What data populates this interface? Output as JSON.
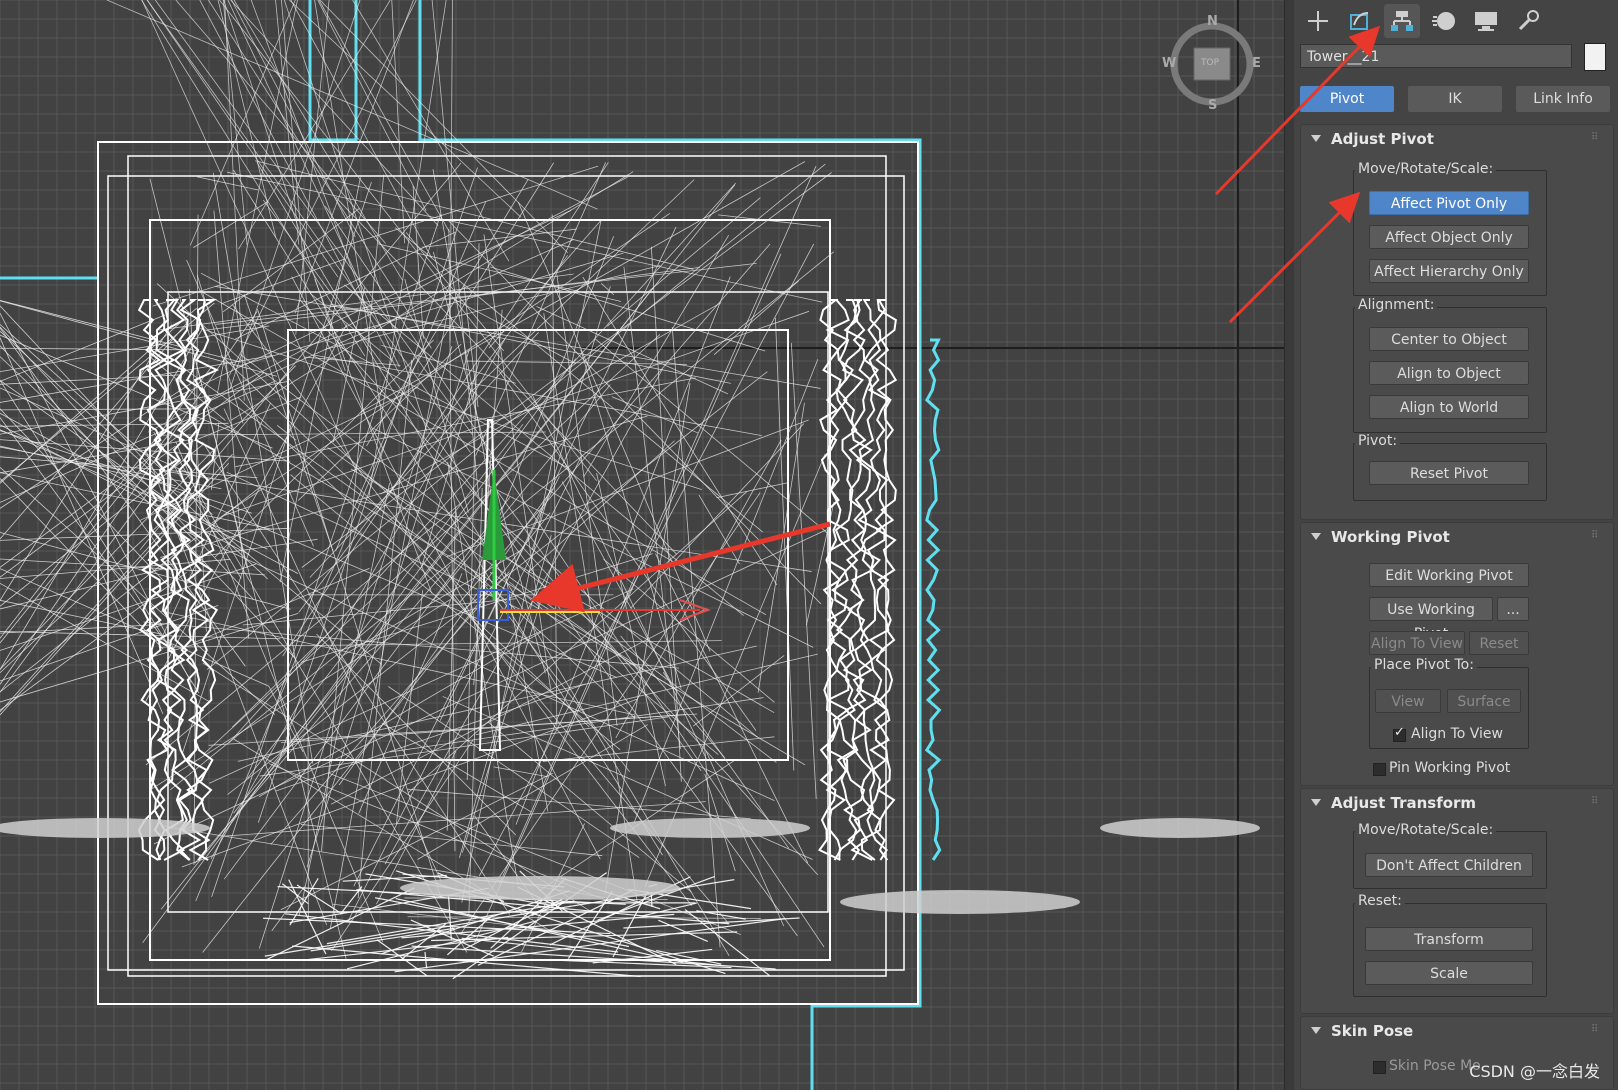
{
  "toolbar": {
    "tabs": [
      {
        "icon": "create-icon",
        "active": false
      },
      {
        "icon": "modify-icon",
        "active": false
      },
      {
        "icon": "hierarchy-icon",
        "active": true
      },
      {
        "icon": "motion-icon",
        "active": false
      },
      {
        "icon": "display-icon",
        "active": false
      },
      {
        "icon": "utilities-icon",
        "active": false
      }
    ]
  },
  "object_name": "Tower__21",
  "subtabs": [
    {
      "label": "Pivot",
      "active": true
    },
    {
      "label": "IK",
      "active": false
    },
    {
      "label": "Link Info",
      "active": false
    }
  ],
  "adjust_pivot": {
    "title": "Adjust Pivot",
    "move_group_label": "Move/Rotate/Scale:",
    "affect_pivot_only": "Affect Pivot Only",
    "affect_object_only": "Affect Object Only",
    "affect_hierarchy_only": "Affect Hierarchy Only",
    "alignment_label": "Alignment:",
    "center_to_object": "Center to Object",
    "align_to_object": "Align to Object",
    "align_to_world": "Align to World",
    "pivot_label": "Pivot:",
    "reset_pivot": "Reset Pivot"
  },
  "working_pivot": {
    "title": "Working Pivot",
    "edit_working_pivot": "Edit Working Pivot",
    "use_working_pivot": "Use Working Pivot",
    "more": "...",
    "align_to_view": "Align To View",
    "reset": "Reset",
    "place_pivot_label": "Place Pivot To:",
    "view": "View",
    "surface": "Surface",
    "align_to_view_check": "Align To View",
    "align_to_view_checked": true,
    "pin_working_pivot": "Pin Working Pivot",
    "pin_checked": false
  },
  "adjust_transform": {
    "title": "Adjust Transform",
    "move_group_label": "Move/Rotate/Scale:",
    "dont_affect_children": "Don't Affect Children",
    "reset_label": "Reset:",
    "transform": "Transform",
    "scale": "Scale"
  },
  "skin_pose": {
    "title": "Skin Pose",
    "truncated_label": "Skin Pose Mo"
  },
  "viewcube": {
    "label": "TOP",
    "n": "N",
    "s": "S",
    "e": "E",
    "w": "W"
  },
  "watermark": "CSDN @一念白发",
  "colors": {
    "accent_blue": "#4f86c9",
    "annotation_red": "#e8382c",
    "wire_cyan": "#5fe0f0",
    "grid": "#5a5a5a"
  }
}
